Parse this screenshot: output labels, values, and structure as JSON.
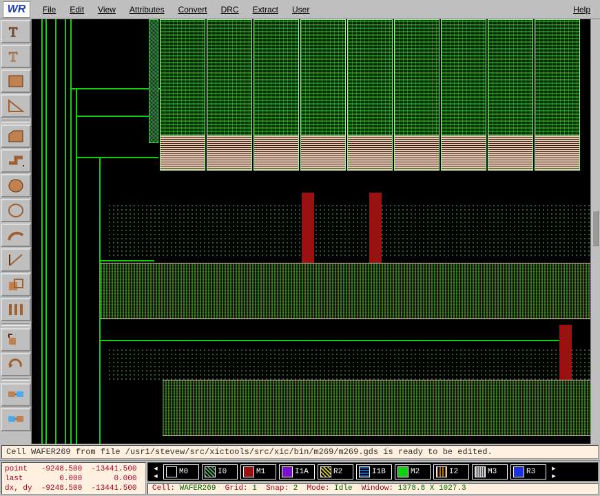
{
  "logo": "WR",
  "menus": [
    "File",
    "Edit",
    "View",
    "Attributes",
    "Convert",
    "DRC",
    "Extract",
    "User"
  ],
  "menu_help": "Help",
  "statusline_text": "Cell WAFER269 from file /usr1/stevew/src/xictools/src/xic/bin/m269/m269.gds is ready to be edited.",
  "coords": {
    "labels": [
      "point",
      "last",
      "dx, dy"
    ],
    "rows": [
      [
        "-9248.500",
        "-13441.500"
      ],
      [
        "0.000",
        "0.000"
      ],
      [
        "-9248.500",
        "-13441.500"
      ]
    ]
  },
  "layers": [
    {
      "name": "M0",
      "color": "#000000"
    },
    {
      "name": "I0",
      "color": "#4aa05a",
      "pattern": "grid"
    },
    {
      "name": "M1",
      "color": "#9a1111"
    },
    {
      "name": "I1A",
      "color": "#7a10cc"
    },
    {
      "name": "R2",
      "color": "#ccbb22",
      "pattern": "cross"
    },
    {
      "name": "I1B",
      "color": "#1064c0",
      "pattern": "hash"
    },
    {
      "name": "M2",
      "color": "#11d011"
    },
    {
      "name": "I2",
      "color": "#b07020",
      "pattern": "grid"
    },
    {
      "name": "M3",
      "color": "#cccccc",
      "pattern": "stripe"
    },
    {
      "name": "R3",
      "color": "#2030e0"
    }
  ],
  "info": {
    "cell_label": "Cell:",
    "cell": "WAFER269",
    "grid_label": "Grid:",
    "grid": "1",
    "snap_label": "Snap:",
    "snap": "2",
    "mode_label": "Mode:",
    "mode": "Idle",
    "window_label": "Window:",
    "window": "1378.8 X 1027.3"
  }
}
